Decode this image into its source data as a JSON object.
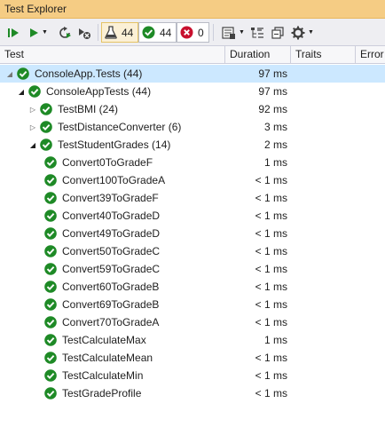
{
  "window": {
    "title": "Test Explorer"
  },
  "toolbar": {
    "run_all_icon": "run-all-icon",
    "run_icon": "run-icon",
    "rerun_icon": "rerun-icon",
    "cancel_icon": "cancel-icon",
    "total_count": "44",
    "passed_count": "44",
    "failed_count": "0",
    "playlist_icon": "playlist-icon",
    "hierarchy_icon": "hierarchy-icon",
    "collapse_icon": "collapse-icon",
    "settings_icon": "gear-icon",
    "colors": {
      "passed": "#1e8a26",
      "failed": "#c8102e",
      "flask": "#424242"
    }
  },
  "columns": [
    "Test",
    "Duration",
    "Traits",
    "Error"
  ],
  "tree": [
    {
      "label": "ConsoleApp.Tests (44)",
      "duration": "97 ms",
      "level": 0,
      "expander": "expanded-hollow",
      "selected": true
    },
    {
      "label": "ConsoleAppTests (44)",
      "duration": "97 ms",
      "level": 1,
      "expander": "expanded"
    },
    {
      "label": "TestBMI (24)",
      "duration": "92 ms",
      "level": 2,
      "expander": "collapsed"
    },
    {
      "label": "TestDistanceConverter (6)",
      "duration": "3 ms",
      "level": 2,
      "expander": "collapsed"
    },
    {
      "label": "TestStudentGrades (14)",
      "duration": "2 ms",
      "level": 2,
      "expander": "expanded"
    },
    {
      "label": "Convert0ToGradeF",
      "duration": "1 ms",
      "level": 3
    },
    {
      "label": "Convert100ToGradeA",
      "duration": "< 1 ms",
      "level": 3
    },
    {
      "label": "Convert39ToGradeF",
      "duration": "< 1 ms",
      "level": 3
    },
    {
      "label": "Convert40ToGradeD",
      "duration": "< 1 ms",
      "level": 3
    },
    {
      "label": "Convert49ToGradeD",
      "duration": "< 1 ms",
      "level": 3
    },
    {
      "label": "Convert50ToGradeC",
      "duration": "< 1 ms",
      "level": 3
    },
    {
      "label": "Convert59ToGradeC",
      "duration": "< 1 ms",
      "level": 3
    },
    {
      "label": "Convert60ToGradeB",
      "duration": "< 1 ms",
      "level": 3
    },
    {
      "label": "Convert69ToGradeB",
      "duration": "< 1 ms",
      "level": 3
    },
    {
      "label": "Convert70ToGradeA",
      "duration": "< 1 ms",
      "level": 3
    },
    {
      "label": "TestCalculateMax",
      "duration": "1 ms",
      "level": 3
    },
    {
      "label": "TestCalculateMean",
      "duration": "< 1 ms",
      "level": 3
    },
    {
      "label": "TestCalculateMin",
      "duration": "< 1 ms",
      "level": 3
    },
    {
      "label": "TestGradeProfile",
      "duration": "< 1 ms",
      "level": 3
    }
  ]
}
